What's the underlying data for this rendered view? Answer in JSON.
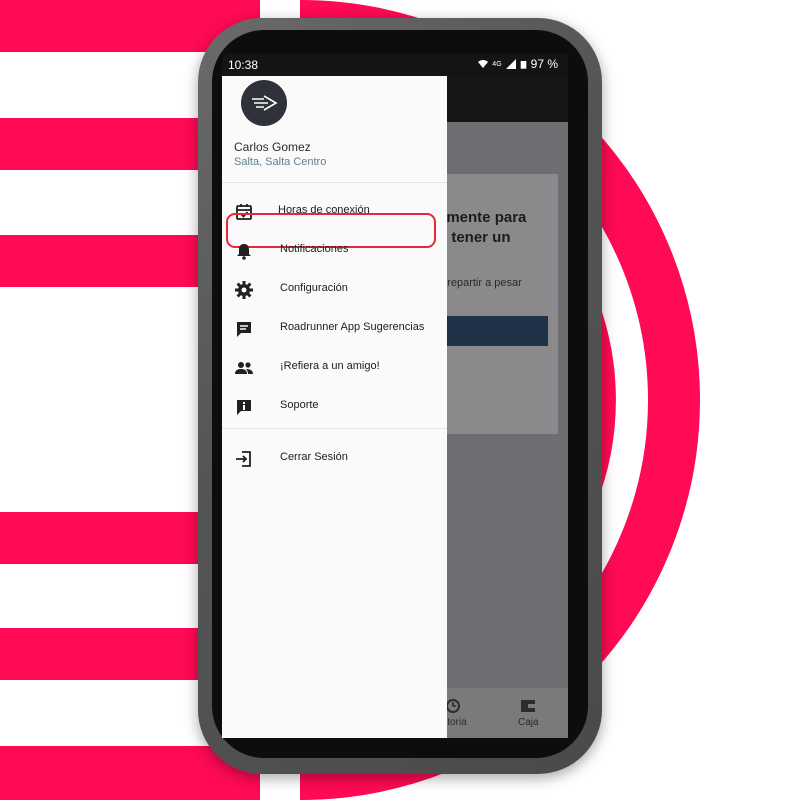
{
  "status_bar": {
    "time": "10:38",
    "network": "4G",
    "battery": "97 %"
  },
  "profile": {
    "name": "Carlos Gomez",
    "location": "Salta, Salta Centro",
    "avatar_icon": "roadrunner-logo-icon"
  },
  "menu": {
    "items": [
      {
        "label": "Horas de conexión",
        "icon": "calendar-check-icon"
      },
      {
        "label": "Notificaciones",
        "icon": "bell-icon"
      },
      {
        "label": "Configuración",
        "icon": "gear-icon"
      },
      {
        "label": "Roadrunner App Sugerencias",
        "icon": "feedback-icon"
      },
      {
        "label": "¡Refiera a un amigo!",
        "icon": "people-icon"
      },
      {
        "label": "Soporte",
        "icon": "info-icon"
      }
    ],
    "logout": {
      "label": "Cerrar Sesión",
      "icon": "logout-icon"
    },
    "highlighted_index": 0
  },
  "background_app": {
    "text_line1": "amente para",
    "text_line2": "o tener un",
    "text_small": "a repartir a pesar",
    "nav": [
      {
        "label": "istoria",
        "icon": "history-icon"
      },
      {
        "label": "Caja",
        "icon": "wallet-icon"
      }
    ]
  },
  "colors": {
    "accent": "#ff0a54",
    "highlight_border": "#e8283a",
    "location_text": "#5f7f93",
    "phone_frame": "#555555"
  }
}
